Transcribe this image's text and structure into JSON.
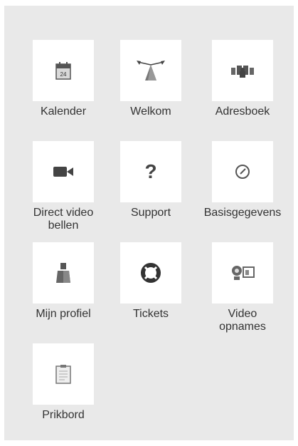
{
  "tiles": [
    {
      "label": "Kalender",
      "icon": "calendar-icon",
      "calendar_day": "24"
    },
    {
      "label": "Welkom",
      "icon": "welcome-signpost-icon"
    },
    {
      "label": "Adresboek",
      "icon": "address-book-icon"
    },
    {
      "label": "Direct video\nbellen",
      "icon": "video-camera-icon"
    },
    {
      "label": "Support",
      "icon": "question-mark-icon"
    },
    {
      "label": "Basisgegevens",
      "icon": "compass-icon"
    },
    {
      "label": "Mijn profiel",
      "icon": "user-profile-icon"
    },
    {
      "label": "Tickets",
      "icon": "lifebuoy-icon"
    },
    {
      "label": "Video\nopnames",
      "icon": "webcam-recording-icon"
    },
    {
      "label": "Prikbord",
      "icon": "clipboard-icon"
    }
  ],
  "colors": {
    "panel_bg": "#e9e9e9",
    "tile_bg": "#ffffff",
    "icon": "#444444",
    "text": "#333333"
  }
}
